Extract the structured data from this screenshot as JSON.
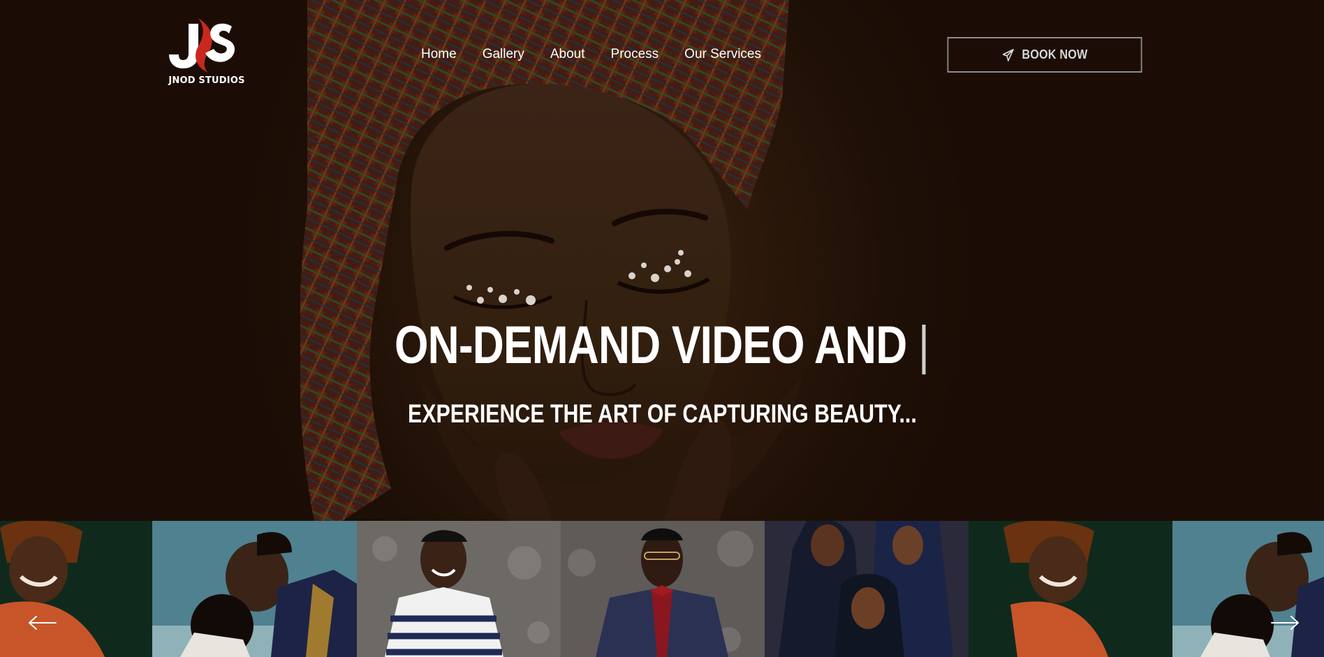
{
  "brand": {
    "name": "JNOD STUDIOS",
    "monogram": "JS"
  },
  "nav": {
    "items": [
      "Home",
      "Gallery",
      "About",
      "Process",
      "Our Services"
    ]
  },
  "cta": {
    "label": "BOOK NOW",
    "icon": "paper-plane-icon"
  },
  "hero": {
    "headline": "ON-DEMAND VIDEO AND",
    "cursor": "|",
    "subline": "EXPERIENCE THE ART OF CAPTURING BEAUTY..."
  },
  "gallery": {
    "photos": [
      {
        "subject": "child-in-orange-scarf"
      },
      {
        "subject": "couple-kissing"
      },
      {
        "subject": "smiling-man-striped-shirt"
      },
      {
        "subject": "man-in-suit-red-bowtie"
      },
      {
        "subject": "three-women-in-hijab"
      },
      {
        "subject": "child-in-orange-scarf"
      },
      {
        "subject": "couple-kissing"
      }
    ],
    "prev_icon": "arrow-left-icon",
    "next_icon": "arrow-right-icon"
  },
  "colors": {
    "background": "#1c0e05",
    "accent_red": "#c8281e",
    "button_border": "#8d8d8d",
    "text": "#ffffff"
  }
}
